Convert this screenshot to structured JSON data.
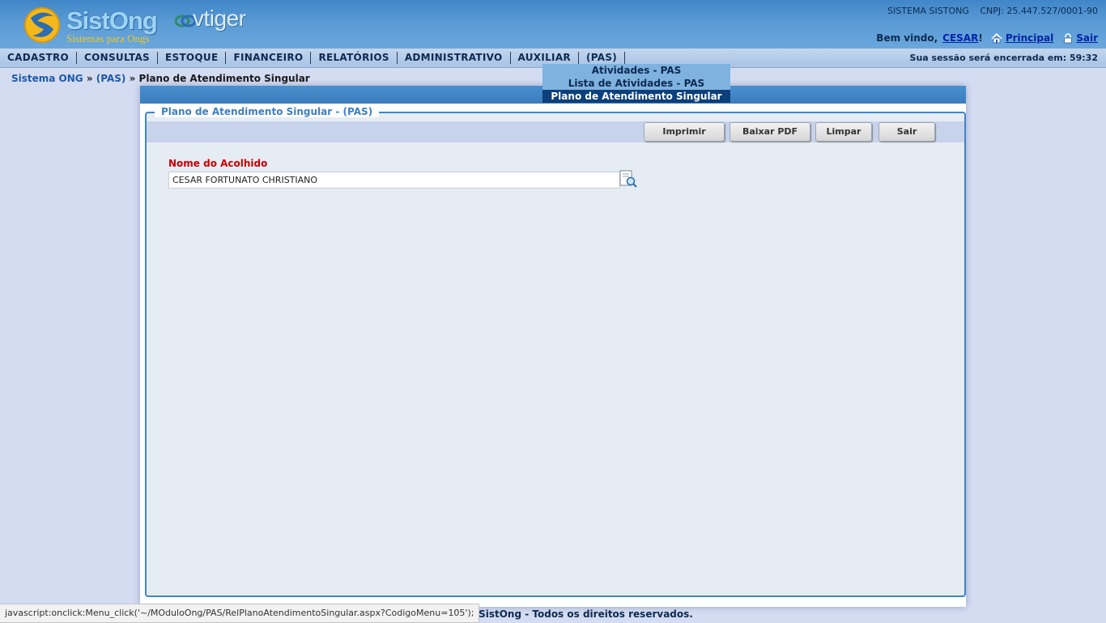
{
  "header": {
    "logo_text": "SistOng",
    "logo_tagline": "Sistemas para Ongs",
    "partner_logo_text": "vtiger",
    "system_name": "SISTEMA SISTONG",
    "cnpj": "CNPJ: 25.447.527/0001-90",
    "welcome_prefix": "Bem vindo,",
    "user_name": "CESAR",
    "welcome_suffix": "!",
    "home_link": "Principal",
    "logout_link": "Sair"
  },
  "menu": {
    "items": [
      "CADASTRO",
      "CONSULTAS",
      "ESTOQUE",
      "FINANCEIRO",
      "RELATÓRIOS",
      "ADMINISTRATIVO",
      "AUXILIAR",
      "(PAS)"
    ],
    "session_text": "Sua sessão será encerrada em: 59:32"
  },
  "dropdown": {
    "items": [
      "Atividades - PAS",
      "Lista de Atividades - PAS",
      "Plano de Atendimento Singular"
    ],
    "active_index": 2
  },
  "breadcrumb": {
    "root": "Sistema ONG",
    "sep": "»",
    "section": "(PAS)",
    "current": "Plano de Atendimento Singular"
  },
  "form": {
    "legend": "Plano de Atendimento Singular - (PAS)",
    "buttons": {
      "print": "Imprimir",
      "pdf": "Baixar PDF",
      "clear": "Limpar",
      "exit": "Sair"
    },
    "field_label": "Nome do Acolhido",
    "field_value": "CESAR FORTUNATO CHRISTIANO"
  },
  "footer": {
    "copyright": ".5 SistOng - Todos os direitos reservados."
  },
  "status_bar": {
    "text": "javascript:onclick:Menu_click('~/MOduloOng/PAS/RelPlanoAtendimentoSingular.aspx?CodigoMenu=105');"
  },
  "colors": {
    "header": "#4a8fce",
    "menubar": "#b8cde9",
    "dropdown": "#7fb2df",
    "dropdown_active": "#0d3f7a",
    "label_red": "#cc0000",
    "background": "#d4dcf2"
  }
}
